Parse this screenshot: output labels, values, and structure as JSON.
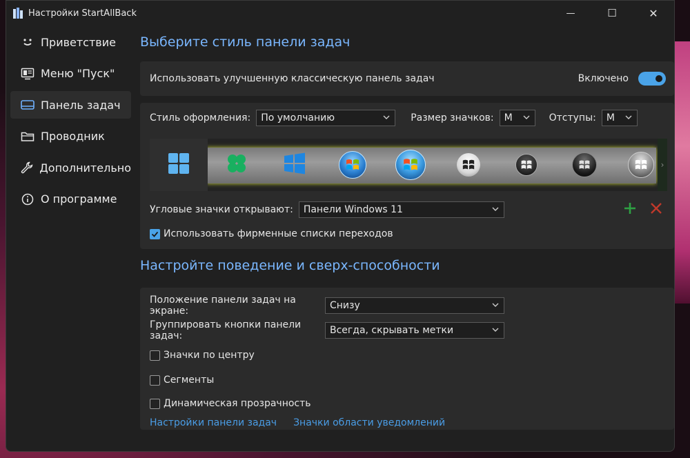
{
  "window": {
    "title": "Настройки StartAllBack",
    "controls": {
      "minimize": "—",
      "maximize": "☐",
      "close": "✕"
    }
  },
  "sidebar": {
    "items": [
      {
        "label": "Приветствие",
        "icon": "smile-icon",
        "active": false
      },
      {
        "label": "Меню \"Пуск\"",
        "icon": "monitor-icon",
        "active": false
      },
      {
        "label": "Панель задач",
        "icon": "taskbar-icon",
        "active": true
      },
      {
        "label": "Проводник",
        "icon": "folder-icon",
        "active": false
      },
      {
        "label": "Дополнительно",
        "icon": "wrench-icon",
        "active": false
      },
      {
        "label": "О программе",
        "icon": "info-icon",
        "active": false
      }
    ]
  },
  "main": {
    "section1_title": "Выберите стиль панели задач",
    "enhanced_taskbar": {
      "label": "Использовать улучшенную классическую панель задач",
      "state": "Включено",
      "enabled": true
    },
    "style": {
      "label": "Стиль оформления:",
      "value": "По умолчанию",
      "icon_size_label": "Размер значков:",
      "icon_size_value": "M",
      "padding_label": "Отступы:",
      "padding_value": "M"
    },
    "taskbar_previews": [
      "win11-logo-icon",
      "clover-logo-icon",
      "win10-logo-icon",
      "win7-orb-icon",
      "vista-orb-icon",
      "white-orb-icon",
      "dark-orb-icon",
      "black-orb-icon",
      "silver-orb-icon"
    ],
    "corner_icons": {
      "label": "Угловые значки открывают:",
      "value": "Панели Windows 11",
      "add": "+",
      "remove": "✕"
    },
    "jump_lists": {
      "label": "Использовать фирменные списки переходов",
      "checked": true
    },
    "section2_title": "Настройте поведение и сверх-способности",
    "position": {
      "label": "Положение панели задач на экране:",
      "value": "Снизу"
    },
    "grouping": {
      "label": "Группировать кнопки панели задач:",
      "value": "Всегда, скрывать метки"
    },
    "center_icons": {
      "label": "Значки по центру",
      "checked": false
    },
    "segments": {
      "label": "Сегменты",
      "checked": false
    },
    "dynamic_transparency": {
      "label": "Динамическая прозрачность",
      "checked": false
    },
    "links": {
      "taskbar_settings": "Настройки панели задач",
      "tray_icons": "Значки области уведомлений"
    }
  },
  "colors": {
    "accent": "#7ab7ff",
    "link": "#4a9de6",
    "toggle_on": "#4aa3e8",
    "add_green": "#2ea043",
    "remove_red": "#c0392b"
  }
}
